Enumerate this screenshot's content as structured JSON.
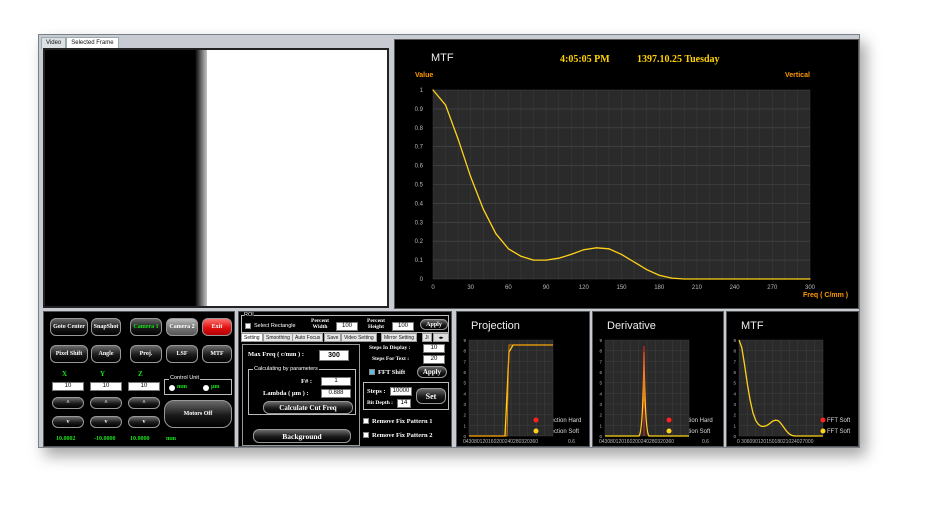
{
  "tabs": [
    {
      "label": "Video",
      "selected": false
    },
    {
      "label": "Selected Frame",
      "selected": true
    }
  ],
  "header": {
    "chart_title": "MTF",
    "time": "4:05:05 PM",
    "date": "1397.10.25 Tuesday",
    "value_label": "Value",
    "vertical_label": "Vertical",
    "freq_label": "Freq ( C/mm )"
  },
  "controls": {
    "buttons": {
      "goto_center": "Goto Center",
      "snapshot": "SnapShot",
      "camera1": "Camera 1",
      "camera2": "Camera 2",
      "exit": "Exit",
      "pixel_shift": "Pixel Shift",
      "angle": "Angle",
      "proj": "Proj.",
      "lsf": "LSF",
      "mtf": "MTF",
      "motors_off": "Motors Off"
    },
    "axes": {
      "x": "X",
      "y": "Y",
      "z": "Z"
    },
    "inputs": {
      "x": "10",
      "y": "10",
      "z": "10"
    },
    "control_unit": {
      "label": "Control Unit",
      "mm": "mm",
      "um": "µm"
    },
    "readouts": {
      "x": "10.0002",
      "y": "-10.0000",
      "z": "10.0000",
      "unit": "mm"
    },
    "arrow_up": "^",
    "arrow_down": "v"
  },
  "settings": {
    "roi_label": "ROI",
    "select_rectangle": "Select Rectangle",
    "percent_width_label": "Percent Width",
    "percent_width": "100",
    "percent_height_label": "Percent Height",
    "percent_height": "100",
    "apply": "Apply",
    "tabs": [
      "Setting",
      "Smoothing",
      "Auto Focus",
      "Save",
      "Video Setting",
      "Mirror Setting",
      "Ji"
    ],
    "max_freq_label": "Max Freq ( c/mm ) :",
    "max_freq": "300",
    "calc_group_label": "Calculating by parameters",
    "f_label": "F# :",
    "f_value": "1",
    "lambda_label": "Lambda ( µm ) :",
    "lambda_value": "0.888",
    "calc_cut_freq": "Calculate Cut Freq",
    "background": "Background",
    "steps_display_label": "Steps In Display :",
    "steps_display": "10",
    "steps_text_label": "Steps For Text :",
    "steps_text": "20",
    "fft_shift": "FFT Shift",
    "apply2": "Apply",
    "steps_label": "Steps :",
    "steps_value": "10000",
    "bit_depth_label": "Bit Depth :",
    "bit_depth": "14",
    "set": "Set",
    "remove1": "Remove Fix Pattern 1",
    "remove2": "Remove Fix Pattern 2"
  },
  "small_charts": [
    {
      "title": "Projection",
      "legend": [
        "Projection Hard",
        "Projection Soft"
      ],
      "xtext": "043080120160200240280320360",
      "xtext_tail": "0.6"
    },
    {
      "title": "Derivative",
      "legend": [
        "Deviation Hard",
        "Deviation Soft"
      ],
      "xtext": "043080120160200240280320360",
      "xtext_tail": "0.6"
    },
    {
      "title": "MTF",
      "legend": [
        "FFT Soft",
        "FFT Soft"
      ],
      "xtext": "0 30609012015018021024027000",
      "colors": {
        "hard": "#ff2020",
        "soft": "#ffd21a"
      }
    }
  ],
  "chart_data": {
    "type": "line",
    "xlim": [
      0,
      300
    ],
    "ylim": [
      0,
      1
    ],
    "xticks": [
      0,
      30,
      60,
      90,
      120,
      150,
      180,
      210,
      240,
      270,
      300
    ],
    "yticks": [
      0,
      0.1,
      0.2,
      0.3,
      0.4,
      0.5,
      0.6,
      0.7,
      0.8,
      0.9,
      1
    ],
    "x": [
      0,
      10,
      20,
      30,
      40,
      50,
      60,
      70,
      80,
      90,
      100,
      110,
      120,
      130,
      140,
      150,
      160,
      170,
      180,
      190,
      200,
      210,
      220,
      230,
      240,
      250,
      260,
      270,
      280,
      290,
      300
    ],
    "values": [
      1,
      0.92,
      0.74,
      0.54,
      0.37,
      0.24,
      0.16,
      0.12,
      0.1,
      0.1,
      0.11,
      0.13,
      0.155,
      0.165,
      0.16,
      0.13,
      0.09,
      0.05,
      0.02,
      0.005,
      0,
      0,
      0,
      0,
      0,
      0,
      0,
      0,
      0,
      0,
      0
    ],
    "color": "#ffd21a",
    "grid": true
  }
}
